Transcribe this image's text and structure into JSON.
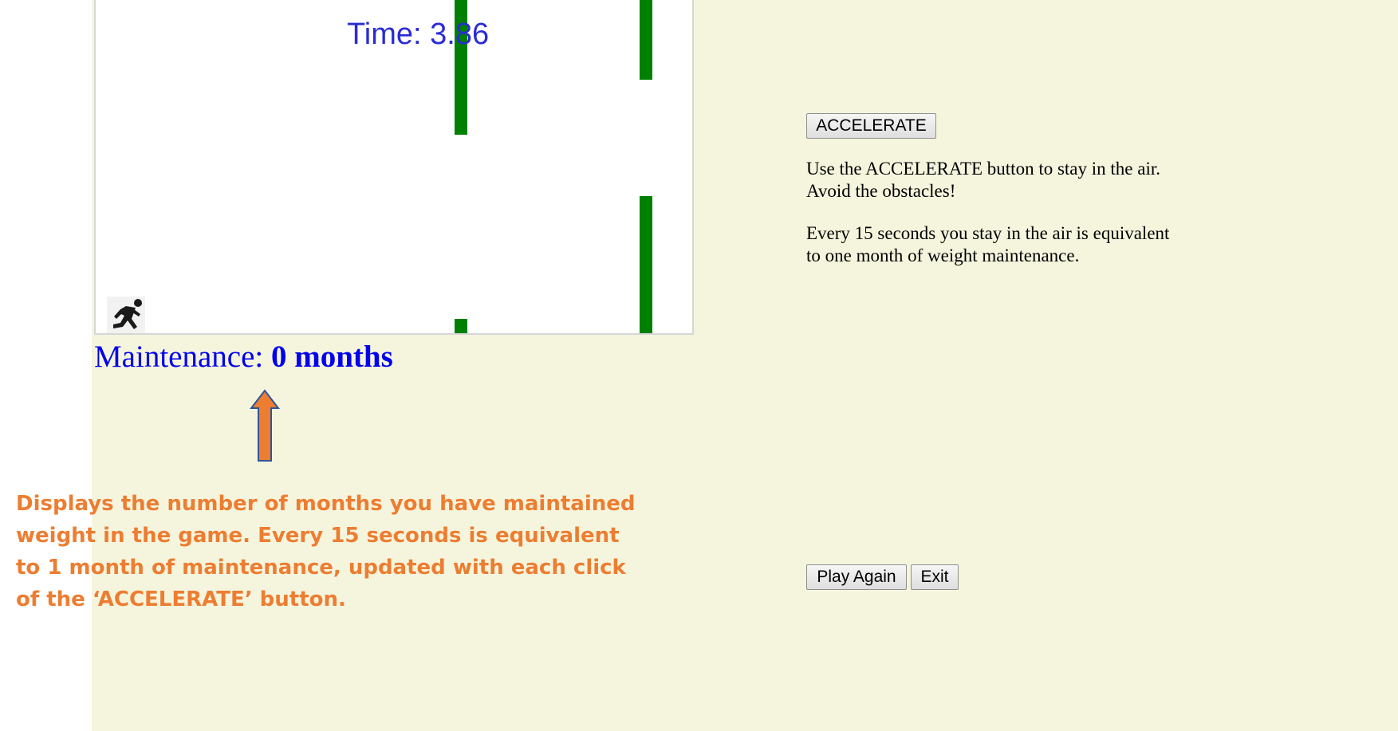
{
  "game": {
    "timer_label": "Time: 3.86",
    "obstacle_color": "#008000",
    "player_icon": "running-person-icon"
  },
  "status": {
    "maintenance_label": "Maintenance:",
    "maintenance_value": "0 months"
  },
  "controls": {
    "accelerate_label": "ACCELERATE",
    "play_again_label": "Play Again",
    "exit_label": "Exit"
  },
  "instructions": {
    "line1": "Use the ACCELERATE button to stay in the air. Avoid the obstacles!",
    "line2": "Every 15 seconds you stay in the air is equivalent to one month of weight maintenance."
  },
  "annotation": {
    "text": "Displays the number of months you have maintained weight in the game.  Every 15 seconds is equivalent to 1 month of maintenance, updated with each click of the ‘ACCELERATE’ button.",
    "color": "#ed7d31",
    "arrow_icon": "up-arrow-icon"
  }
}
